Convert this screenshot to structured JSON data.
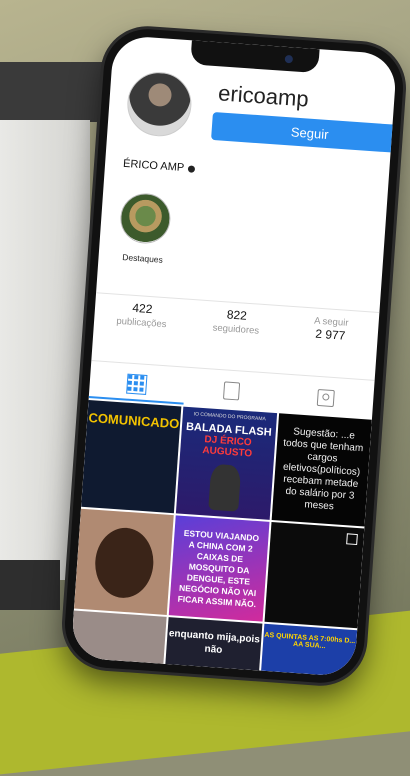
{
  "profile": {
    "username": "ericoamp",
    "follow_label": "Seguir",
    "display_name": "ÉRICO AMP"
  },
  "highlights": [
    {
      "label": "Destaques"
    }
  ],
  "stats": [
    {
      "value": "422",
      "label": "publicações"
    },
    {
      "value": "822",
      "label": "seguidores"
    },
    {
      "value": "2 977",
      "label": "A seguir"
    }
  ],
  "tabs": [
    "grid-icon",
    "tv-icon",
    "tagged-icon"
  ],
  "posts": {
    "p1_title": "COMUNICADO",
    "p2_small": "IO COMANDO DO PROGRAMA",
    "p2_title": "BALADA FLASH",
    "p2_sub": "DJ ÉRICO AUGUSTO",
    "p3_text": "Sugestão: ...e todos que tenham cargos eletivos(políticos) recebam metade do salário por 3 meses",
    "p5_text": "ESTOU VIAJANDO A CHINA COM 2 CAIXAS DE MOSQUITO DA DENGUE, ESTE NEGÓCIO NÃO VAI FICAR ASSIM NÃO.",
    "p8_text": "enquanto mija,pois não",
    "p9_text": "AS QUINTAS AS 7:00hs D... AA SUA..."
  },
  "colors": {
    "accent": "#2b8ef0"
  }
}
